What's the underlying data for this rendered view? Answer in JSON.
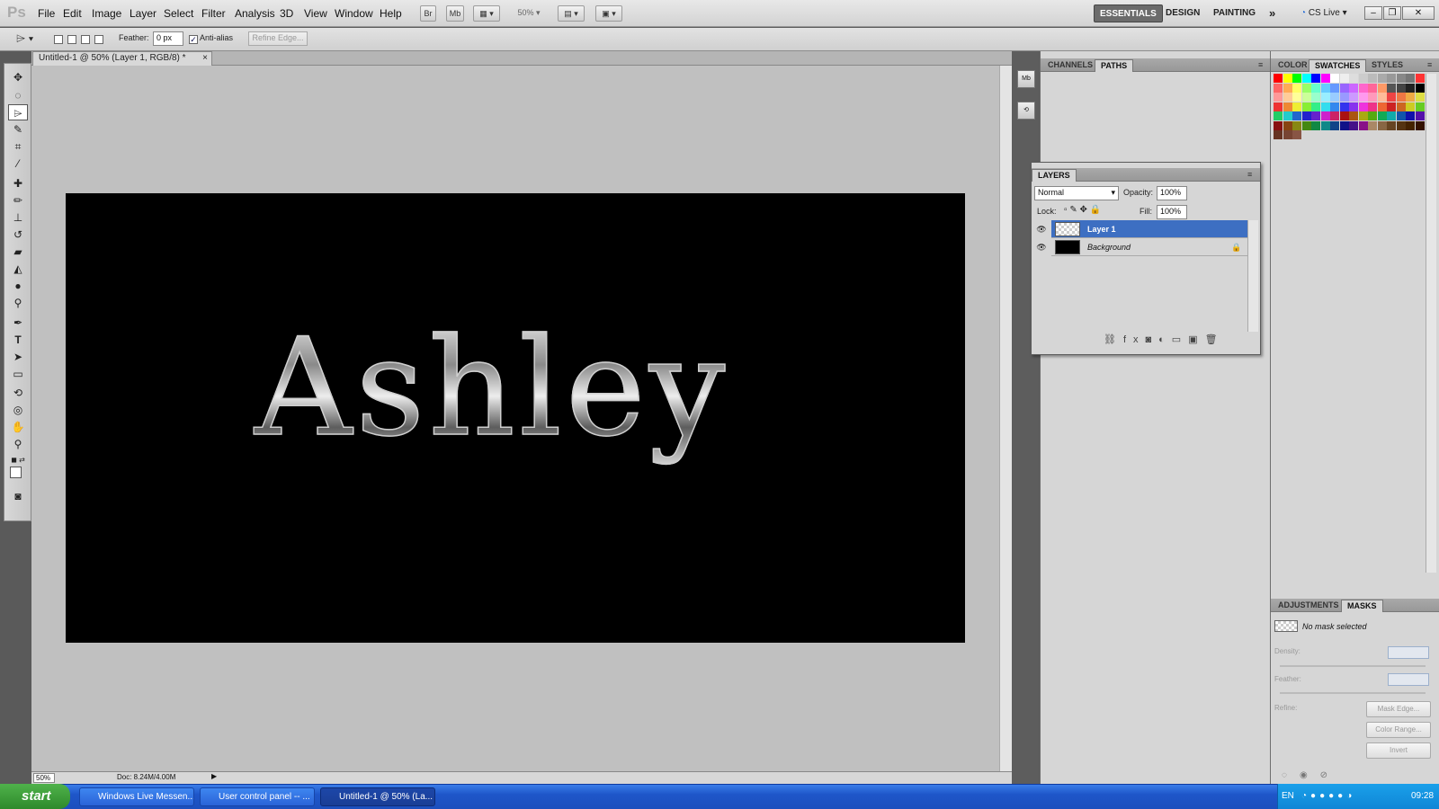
{
  "app": {
    "logo": "Ps"
  },
  "menu": [
    "File",
    "Edit",
    "Image",
    "Layer",
    "Select",
    "Filter",
    "Analysis",
    "3D",
    "View",
    "Window",
    "Help"
  ],
  "menubar_buttons": {
    "bridge": "Br",
    "mini_bridge": "Mb",
    "zoom": "50%"
  },
  "workspaces": {
    "essentials": "ESSENTIALS",
    "design": "DESIGN",
    "painting": "PAINTING",
    "more": "»",
    "cslive": "CS Live"
  },
  "options": {
    "feather_label": "Feather:",
    "feather_value": "0 px",
    "antialias_label": "Anti-alias",
    "refine_edge": "Refine Edge..."
  },
  "document": {
    "tab_title": "Untitled-1 @ 50% (Layer 1, RGB/8) *",
    "close": "×",
    "text": "Ashley"
  },
  "status": {
    "zoom": "50%",
    "doc": "Doc: 8.24M/4.00M"
  },
  "mid_panel": {
    "tabs": [
      "CHANNELS",
      "PATHS"
    ]
  },
  "layers_panel": {
    "tab": "LAYERS",
    "blend_mode": "Normal",
    "opacity_label": "Opacity:",
    "opacity": "100%",
    "lock_label": "Lock:",
    "fill_label": "Fill:",
    "fill": "100%",
    "layers": [
      {
        "name": "Layer 1",
        "selected": true
      },
      {
        "name": "Background",
        "selected": false
      }
    ]
  },
  "right_panel": {
    "tabs": [
      "COLOR",
      "SWATCHES",
      "STYLES"
    ],
    "lower_tabs": [
      "ADJUSTMENTS",
      "MASKS"
    ],
    "mask_status": "No mask selected",
    "density_label": "Density:",
    "feather_label": "Feather:",
    "refine_label": "Refine:",
    "mask_edge": "Mask Edge...",
    "color_range": "Color Range...",
    "invert": "Invert"
  },
  "taskbar": {
    "start": "start",
    "tasks": [
      "Windows Live Messen...",
      "User control panel -- ...",
      "Untitled-1 @ 50% (La..."
    ],
    "lang": "EN",
    "time": "09:28"
  },
  "colors": {
    "selection_blue": "#3d6fc2",
    "canvas_gray": "#c0c0c0",
    "taskbar_blue": "#2a63d8"
  }
}
